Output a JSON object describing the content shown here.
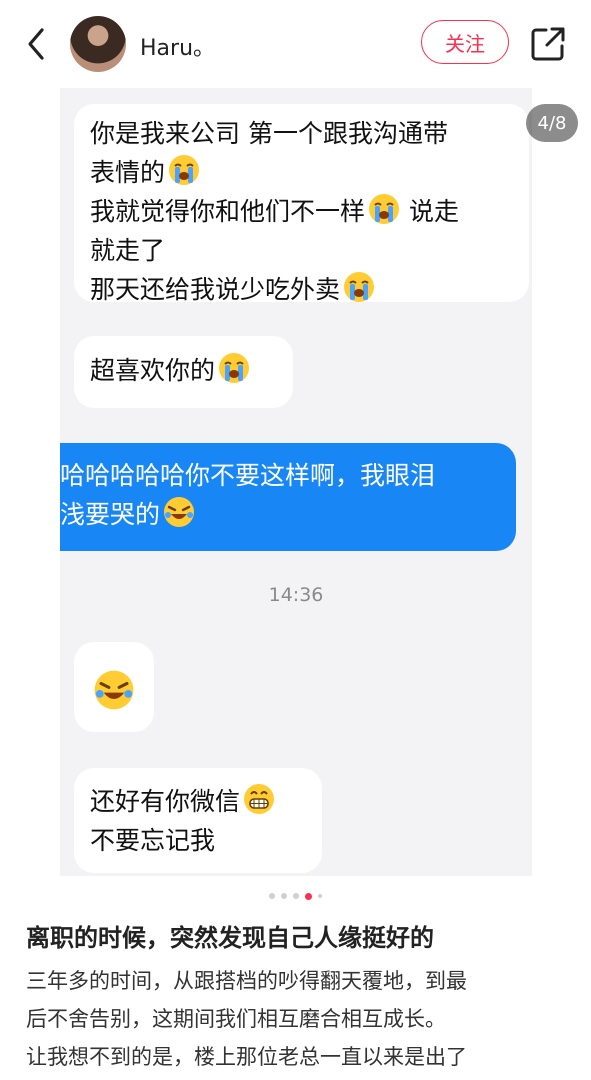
{
  "header": {
    "username": "Haru。",
    "follow_label": "关注"
  },
  "pager": {
    "label": "4/8",
    "current": 4,
    "total": 8
  },
  "chat": {
    "bubble1_lines": [
      "你是我来公司 第一个跟我沟通带",
      "表情的",
      "我就觉得你和他们不一样",
      "就走了",
      "那天还给我说少吃外卖"
    ],
    "bubble1_line3_suffix": " 说走",
    "bubble2_text": "超喜欢你的",
    "bubble3_lines": [
      "哈哈哈哈哈你不要这样啊，我眼泪",
      "浅要哭的"
    ],
    "timestamp": "14:36",
    "bubble5_lines": [
      "还好有你微信",
      "不要忘记我"
    ]
  },
  "post": {
    "title": "离职的时候，突然发现自己人缘挺好的",
    "body_lines": [
      "三年多的时间，从跟搭档的吵得翻天覆地，到最",
      "后不舍告别，这期间我们相互磨合相互成长。",
      "让我想不到的是，楼上那位老总一直以来是出了"
    ]
  },
  "icons": {
    "back": "chevron-left-icon",
    "share": "share-icon",
    "crying": "loudly-crying-emoji-icon",
    "laughing-tears": "laughing-tears-emoji-icon",
    "grinning": "grinning-emoji-icon"
  },
  "colors": {
    "accent": "#ff2e4d",
    "sent_bubble": "#1887f5",
    "chat_bg": "#f3f3f5"
  }
}
